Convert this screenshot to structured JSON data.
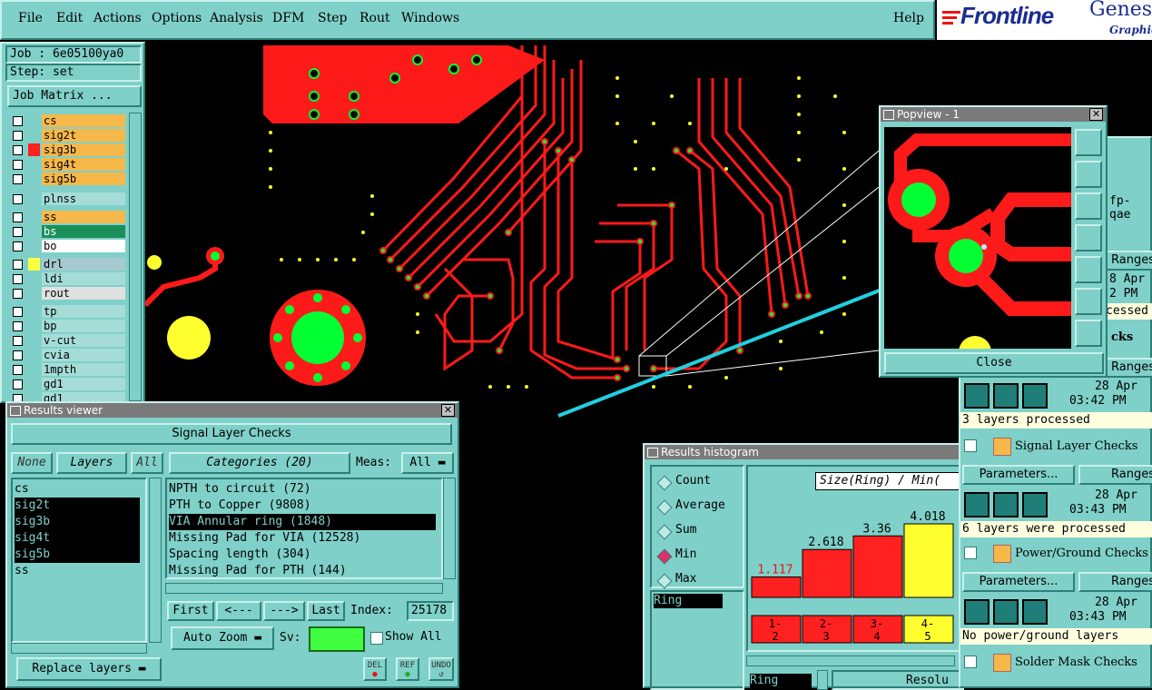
{
  "menubar": {
    "items": [
      "File",
      "Edit",
      "Actions",
      "Options",
      "Analysis",
      "DFM",
      "Step",
      "Rout",
      "Windows"
    ],
    "help": "Help"
  },
  "brand": {
    "logo": "Frontline",
    "product": "Genesi",
    "sub": "Graphic"
  },
  "job": {
    "job_label": "Job : 6e05100ya0",
    "step_label": "Step: set",
    "matrix_button": "Job Matrix ..."
  },
  "layers": [
    {
      "name": "cs",
      "color": "#f7b84a"
    },
    {
      "name": "sig2t",
      "color": "#f7b84a"
    },
    {
      "name": "sig3b",
      "color": "#f7b84a",
      "marker": "#ff2020"
    },
    {
      "name": "sig4t",
      "color": "#f7b84a"
    },
    {
      "name": "sig5b",
      "color": "#f7b84a"
    },
    {
      "name": "plnss",
      "color": "#a5dcd8"
    },
    {
      "name": "ss",
      "color": "#f7b84a"
    },
    {
      "name": "bs",
      "color": "#1a8f5a"
    },
    {
      "name": "bo",
      "color": "#ffffff"
    },
    {
      "name": "drl",
      "color": "#a5c9cf",
      "marker": "#ffff40"
    },
    {
      "name": "ldi",
      "color": "#a5dcd8"
    },
    {
      "name": "rout",
      "color": "#e0e0e0"
    },
    {
      "name": "tp",
      "color": "#a5dcd8"
    },
    {
      "name": "bp",
      "color": "#a5dcd8"
    },
    {
      "name": "v-cut",
      "color": "#a5dcd8"
    },
    {
      "name": "cvia",
      "color": "#a5dcd8"
    },
    {
      "name": "1mpth",
      "color": "#a5dcd8"
    },
    {
      "name": "gd1",
      "color": "#a5dcd8"
    },
    {
      "name": "gd1",
      "color": "#a5dcd8"
    }
  ],
  "results_viewer": {
    "title": "Results viewer",
    "header": "Signal Layer Checks",
    "none_btn": "None",
    "layers_btn": "Layers",
    "all_btn": "All",
    "layer_list": [
      "cs",
      "sig2t",
      "sig3b",
      "sig4t",
      "sig5b",
      "ss"
    ],
    "categories_btn": "Categories (20)",
    "meas_label": "Meas:",
    "meas_value": "All",
    "categories": [
      "NPTH to circuit (72)",
      "PTH to Copper (9808)",
      "VIA Annular ring (1848)",
      "Missing Pad for VIA (12528)",
      "Spacing length (304)",
      "Missing Pad for PTH (144)"
    ],
    "first_btn": "First",
    "prev_btn": "<---",
    "next_btn": "--->",
    "last_btn": "Last",
    "index_label": "Index:",
    "index_value": "25178",
    "autozoom_btn": "Auto Zoom",
    "sv_label": "Sv:",
    "show_all": "Show All",
    "replace_btn": "Replace layers",
    "del_btn": "DEL",
    "ref_btn": "REF",
    "undo_btn": "UNDO"
  },
  "popview": {
    "title": "Popview - 1",
    "close_btn": "Close"
  },
  "histogram": {
    "title": "Results histogram",
    "options": [
      "Count",
      "Average",
      "Sum",
      "Min",
      "Max"
    ],
    "selected": "Min",
    "ring_label": "Ring",
    "chart_title": "Size(Ring) / Min(",
    "ring_label2": "Ring",
    "resol_label": "Resolu",
    "chart_data": {
      "type": "bar",
      "categories": [
        "1-2",
        "2-3",
        "3-4",
        "4-5"
      ],
      "values": [
        1.117,
        2.618,
        3.36,
        4.018
      ],
      "colors": [
        "#ff2020",
        "#ff2020",
        "#ff2020",
        "#ffff30"
      ]
    }
  },
  "checklist": {
    "fp_label": "fp-qae",
    "ranges": "Ranges",
    "processed_partial": "cessed",
    "checks_partial": "cks",
    "date1": "28 Apr",
    "time1": "03:42 PM",
    "layers_processed": "3 layers processed",
    "signal_checks": "Signal Layer Checks",
    "parameters": "Parameters...",
    "date2": "28 Apr",
    "time2": "03:43 PM",
    "layers_were_processed": "6 layers were processed",
    "power_checks": "Power/Ground Checks",
    "date3": "28 Apr",
    "time3": "03:43 PM",
    "no_power": "No power/ground layers",
    "solder_checks": "Solder Mask Checks",
    "date0": "8 Apr",
    "time0": "2 PM"
  }
}
